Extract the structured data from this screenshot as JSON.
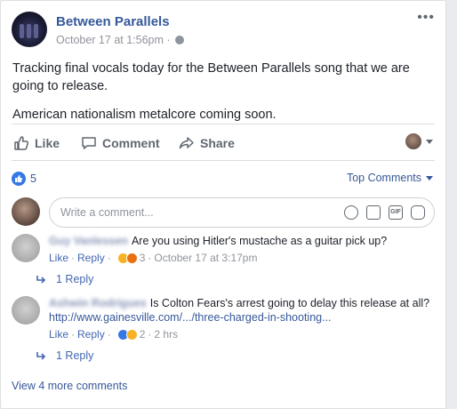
{
  "post": {
    "page_name": "Between Parallels",
    "timestamp": "October 17 at 1:56pm",
    "separator": "·",
    "more_icon": "•••",
    "text_lines": [
      "Tracking final vocals today for the Between Parallels song that we are going to release.",
      "American nationalism metalcore coming soon."
    ]
  },
  "actions": {
    "like": "Like",
    "comment": "Comment",
    "share": "Share"
  },
  "reactions": {
    "count": "5",
    "sort_label": "Top Comments"
  },
  "composer": {
    "placeholder": "Write a comment..."
  },
  "comments": [
    {
      "author": "Guy Vanlessen",
      "text": "Are you using Hitler's mustache as a guitar pick up?",
      "link": "",
      "like": "Like",
      "reply": "Reply",
      "reaction_count": "3",
      "time": "October 17 at 3:17pm",
      "replies": "1 Reply"
    },
    {
      "author": "Ashwin Rodrigues",
      "text": "Is Colton Fears's arrest going to delay this release at all?",
      "link": "http://www.gainesville.com/.../three-charged-in-shooting...",
      "like": "Like",
      "reply": "Reply",
      "reaction_count": "2",
      "time": "2 hrs",
      "replies": "1 Reply"
    }
  ],
  "view_more": "View 4 more comments",
  "colors": {
    "link": "#365899",
    "accent": "#3578e5",
    "muted": "#90949c"
  }
}
